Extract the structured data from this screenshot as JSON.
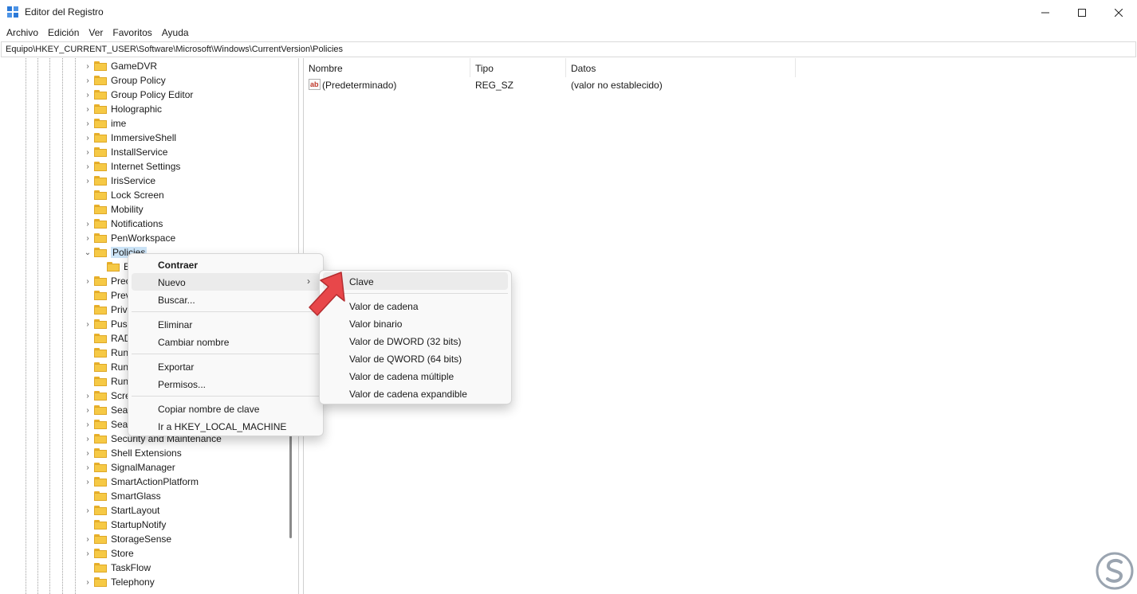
{
  "window": {
    "title": "Editor del Registro"
  },
  "menu": [
    "Archivo",
    "Edición",
    "Ver",
    "Favoritos",
    "Ayuda"
  ],
  "address": "Equipo\\HKEY_CURRENT_USER\\Software\\Microsoft\\Windows\\CurrentVersion\\Policies",
  "tree": {
    "items": [
      {
        "label": "GameDVR",
        "expandable": true
      },
      {
        "label": "Group Policy",
        "expandable": true
      },
      {
        "label": "Group Policy Editor",
        "expandable": true
      },
      {
        "label": "Holographic",
        "expandable": true
      },
      {
        "label": "ime",
        "expandable": true
      },
      {
        "label": "ImmersiveShell",
        "expandable": true
      },
      {
        "label": "InstallService",
        "expandable": true
      },
      {
        "label": "Internet Settings",
        "expandable": true
      },
      {
        "label": "IrisService",
        "expandable": true
      },
      {
        "label": "Lock Screen",
        "expandable": false
      },
      {
        "label": "Mobility",
        "expandable": false
      },
      {
        "label": "Notifications",
        "expandable": true
      },
      {
        "label": "PenWorkspace",
        "expandable": true
      },
      {
        "label": "Policies",
        "expandable": true,
        "expanded": true,
        "selected": true
      },
      {
        "label": "E",
        "expandable": false,
        "child": true
      },
      {
        "label": "Prec",
        "expandable": true
      },
      {
        "label": "Prev",
        "expandable": false
      },
      {
        "label": "Priv",
        "expandable": false
      },
      {
        "label": "Pus",
        "expandable": true
      },
      {
        "label": "RAD",
        "expandable": false
      },
      {
        "label": "Run",
        "expandable": false
      },
      {
        "label": "Run",
        "expandable": false
      },
      {
        "label": "Run",
        "expandable": false
      },
      {
        "label": "Scre",
        "expandable": true
      },
      {
        "label": "Sear",
        "expandable": true
      },
      {
        "label": "Sear",
        "expandable": true
      },
      {
        "label": "Security and Maintenance",
        "expandable": true
      },
      {
        "label": "Shell Extensions",
        "expandable": true
      },
      {
        "label": "SignalManager",
        "expandable": true
      },
      {
        "label": "SmartActionPlatform",
        "expandable": true
      },
      {
        "label": "SmartGlass",
        "expandable": false
      },
      {
        "label": "StartLayout",
        "expandable": true
      },
      {
        "label": "StartupNotify",
        "expandable": false
      },
      {
        "label": "StorageSense",
        "expandable": true
      },
      {
        "label": "Store",
        "expandable": true
      },
      {
        "label": "TaskFlow",
        "expandable": false
      },
      {
        "label": "Telephony",
        "expandable": true
      }
    ]
  },
  "list": {
    "columns": [
      "Nombre",
      "Tipo",
      "Datos"
    ],
    "rows": [
      {
        "name": "(Predeterminado)",
        "type": "REG_SZ",
        "data": "(valor no establecido)",
        "icon": "string-value-icon"
      }
    ]
  },
  "context_menu": {
    "items": [
      "Contraer",
      "Nuevo",
      "Buscar...",
      "Eliminar",
      "Cambiar nombre",
      "Exportar",
      "Permisos...",
      "Copiar nombre de clave",
      "Ir a HKEY_LOCAL_MACHINE"
    ]
  },
  "submenu": {
    "items": [
      "Clave",
      "Valor de cadena",
      "Valor binario",
      "Valor de DWORD (32 bits)",
      "Valor de QWORD (64 bits)",
      "Valor de cadena múltiple",
      "Valor de cadena expandible"
    ]
  },
  "colors": {
    "selection": "#cce4f7",
    "folder": "#f6c945",
    "arrow": "#e8474a"
  }
}
